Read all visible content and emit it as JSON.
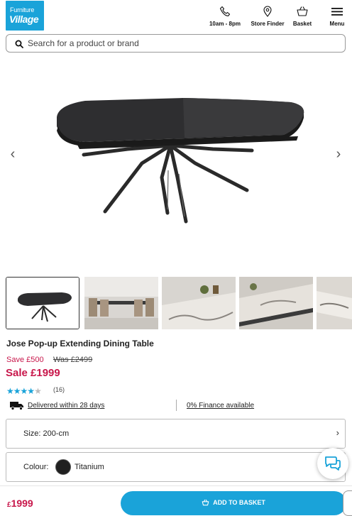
{
  "brand": {
    "logo_line1": "Furniture",
    "logo_line2": "Village"
  },
  "header": {
    "phone_label": "10am - 8pm",
    "store_label": "Store Finder",
    "basket_label": "Basket",
    "menu_label": "Menu",
    "icons": [
      "phone-icon",
      "location-pin-icon",
      "basket-icon",
      "hamburger-menu-icon"
    ]
  },
  "search": {
    "placeholder": "Search for a product or brand",
    "value": ""
  },
  "gallery": {
    "prev_arrow": "‹",
    "next_arrow": "›",
    "thumbnails": [
      "Table product shot",
      "Dining room scene",
      "Tabletop marble close-up",
      "Extension mechanism close-up",
      "Table detail"
    ],
    "selected_index": 0
  },
  "product": {
    "title": "Jose Pop-up Extending Dining Table",
    "save_text": "Save £500",
    "was_text": "Was £2499",
    "sale_text": "Sale £1999",
    "rating": 4,
    "rating_max": 5,
    "review_count": "(16)",
    "colors": {
      "accent": "#1aa3d9",
      "sale": "#c8174b"
    }
  },
  "info": {
    "delivery_text": "Delivered within 28 days",
    "finance_text": "0% Finance available"
  },
  "options": {
    "size_text": "Size: 200-cm",
    "colour_label": "Colour:",
    "colour_name": "Titanium",
    "colour_hex": "#202020"
  },
  "bottom_bar": {
    "currency": "£",
    "price": "1999",
    "add_button": "ADD TO BASKET"
  }
}
